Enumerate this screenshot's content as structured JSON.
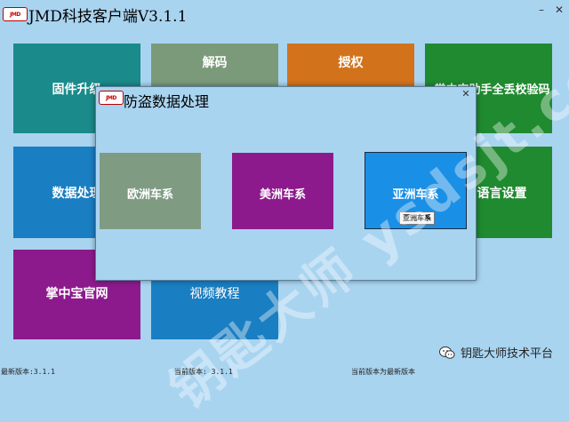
{
  "app": {
    "title": "JMD科技客户端V3.1.1",
    "logo_text": "JMD"
  },
  "window_controls": {
    "minimize": "–",
    "close": "✕"
  },
  "tiles": [
    {
      "label": "固件升级",
      "color": "#1a8a8a"
    },
    {
      "label": "解码",
      "color": "#7a9a7a"
    },
    {
      "label": "授权",
      "color": "#d2731c"
    },
    {
      "label": "掌中宝助手全丢校验码",
      "color": "#1f8a2f"
    },
    {
      "label": "数据处理",
      "color": "#1a7ec2"
    },
    {
      "label": "语言设置",
      "color": "#1f8a2f"
    },
    {
      "label": "掌中宝官网",
      "color": "#8c1a8c"
    },
    {
      "label": "视频教程",
      "color": "#1a7ec2"
    }
  ],
  "dialog": {
    "title": "防盗数据处理",
    "close": "✕",
    "options": [
      {
        "label": "欧洲车系",
        "color": "#7f9c83"
      },
      {
        "label": "美洲车系",
        "color": "#8c1a8c"
      },
      {
        "label": "亚洲车系",
        "color": "#1a8fe6"
      }
    ],
    "tooltip": "亚洲车系"
  },
  "status_bar": {
    "left": "最新版本:3.1.1",
    "middle": "当前版本: 3.1.1",
    "right": "当前版本为最新版本"
  },
  "watermark": {
    "text": "钥匙大师技术平台",
    "diagonal": "钥匙大师 ysdsjt.com 论坛"
  }
}
